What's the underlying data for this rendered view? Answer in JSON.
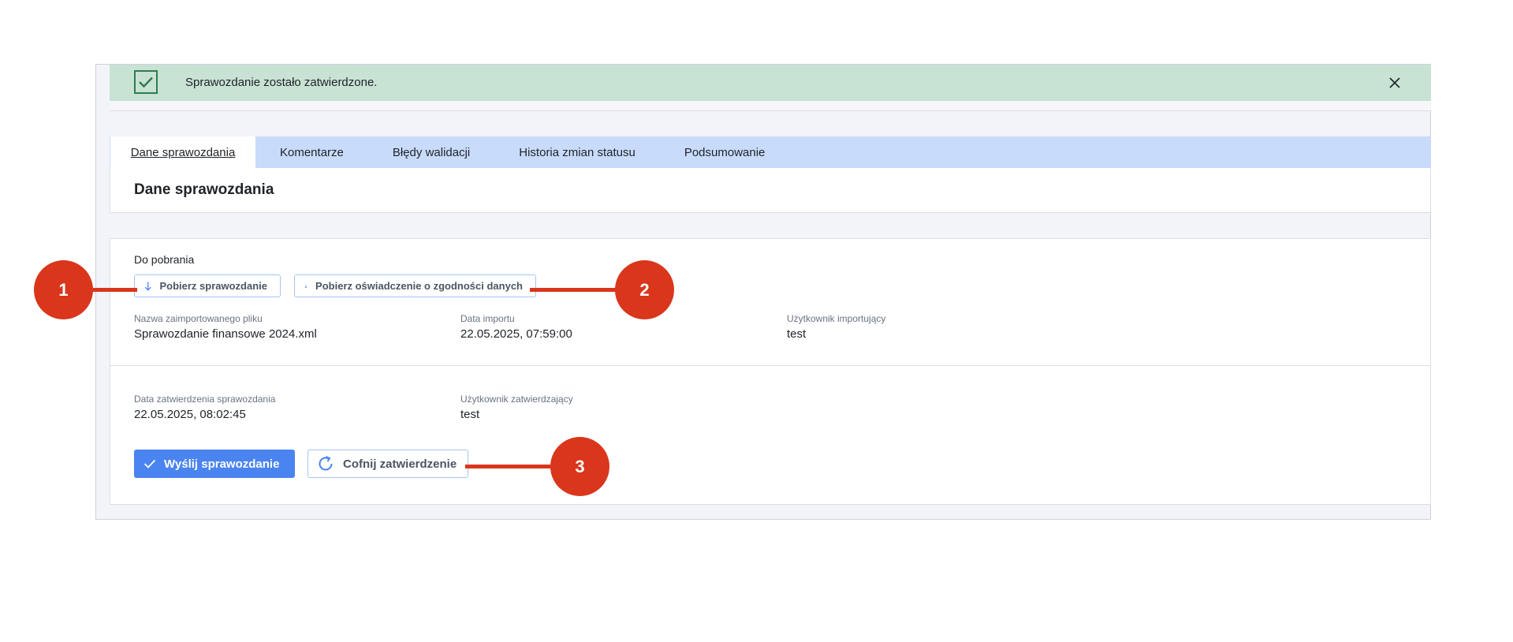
{
  "alert": {
    "message": "Sprawozdanie zostało zatwierdzone.",
    "icon": "check-icon",
    "close_icon": "close-icon",
    "color": "#c8e2d4"
  },
  "tabs": [
    {
      "label": "Dane sprawozdania",
      "active": true
    },
    {
      "label": "Komentarze",
      "active": false
    },
    {
      "label": "Błędy walidacji",
      "active": false
    },
    {
      "label": "Historia zmian statusu",
      "active": false
    },
    {
      "label": "Podsumowanie",
      "active": false
    }
  ],
  "header": {
    "title": "Dane sprawozdania"
  },
  "downloads": {
    "label": "Do pobrania",
    "buttons": [
      {
        "label": "Pobierz sprawozdanie",
        "icon": "arrow-down-icon"
      },
      {
        "label": "Pobierz oświadczenie o zgodności danych",
        "icon": "arrow-down-icon"
      }
    ]
  },
  "import_info": [
    {
      "label": "Nazwa zaimportowanego pliku",
      "value": "Sprawozdanie finansowe 2024.xml"
    },
    {
      "label": "Data importu",
      "value": "22.05.2025, 07:59:00"
    },
    {
      "label": "Użytkownik importujący",
      "value": "test"
    }
  ],
  "approval_info": [
    {
      "label": "Data zatwierdzenia sprawozdania",
      "value": "22.05.2025, 08:02:45"
    },
    {
      "label": "Użytkownik zatwierdzający",
      "value": "test"
    }
  ],
  "actions": {
    "send_label": "Wyślij sprawozdanie",
    "send_icon": "check-icon",
    "undo_label": "Cofnij zatwierdzenie",
    "undo_icon": "refresh-icon",
    "primary_color": "#4a84f0"
  },
  "markers": [
    "1",
    "2",
    "3"
  ],
  "marker_color": "#d9361b"
}
